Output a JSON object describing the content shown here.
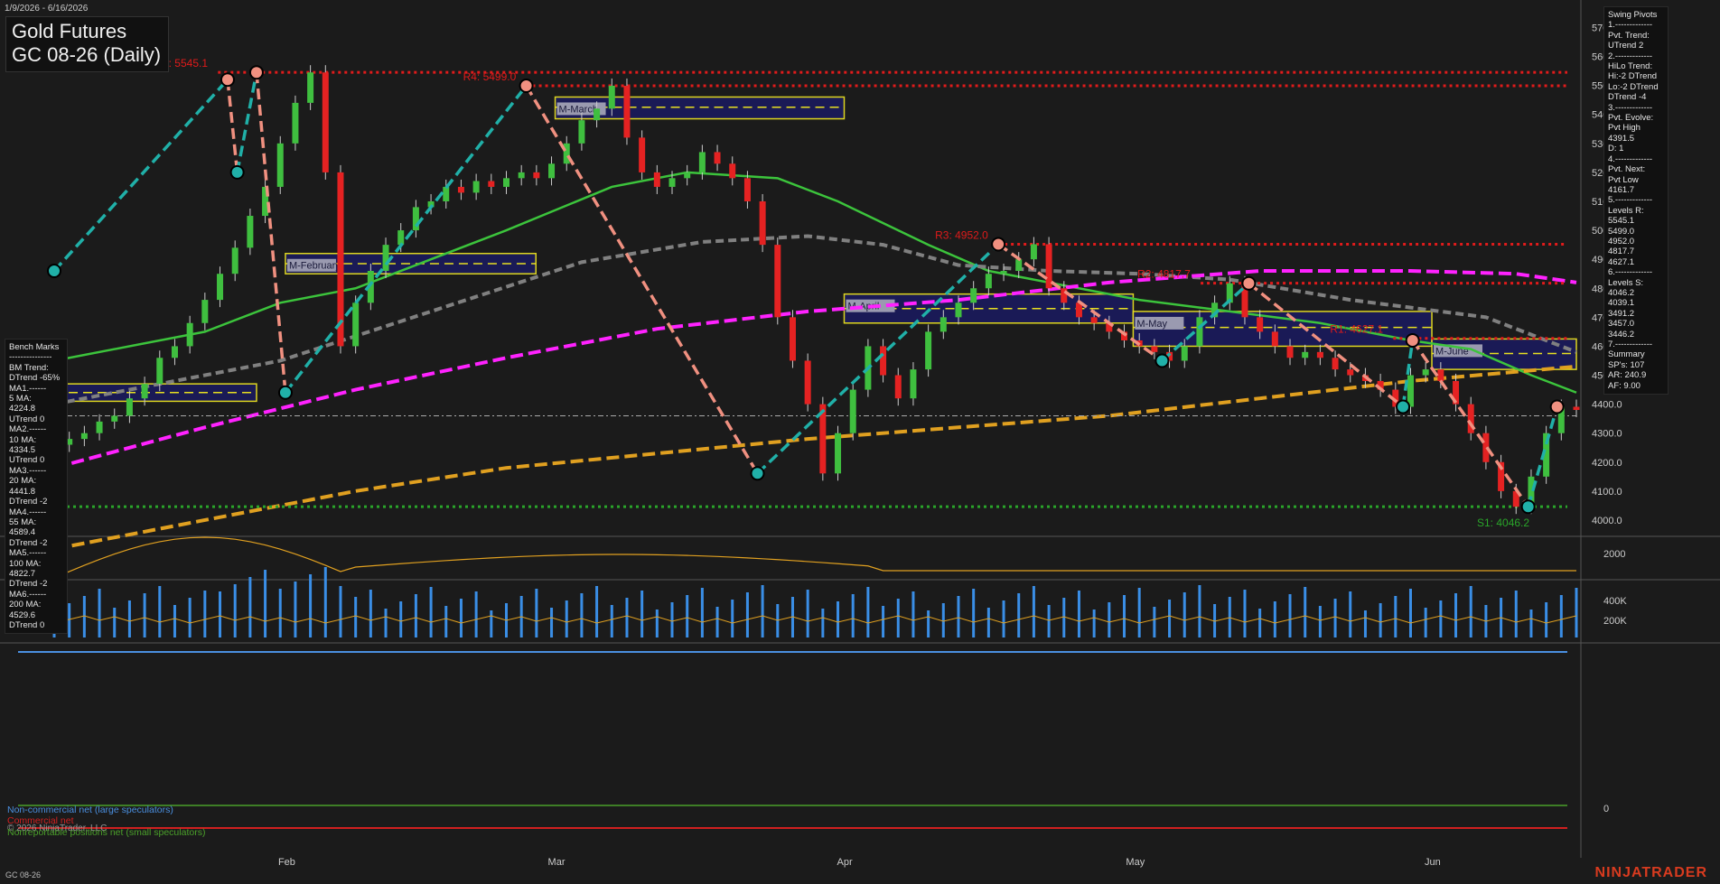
{
  "header": {
    "date_range": "1/9/2026 - 6/16/2026",
    "title_line1": "Gold Futures",
    "title_line2": "GC 08-26 (Daily)"
  },
  "swing_panel": [
    "Swing Pivots",
    "1.-------------",
    "Pvt. Trend:",
    "UTrend 2",
    "2.-------------",
    "HiLo Trend:",
    "Hi:-2 DTrend",
    "Lo:-2 DTrend",
    "DTrend -4",
    "3.-------------",
    "Pvt. Evolve:",
    "Pvt High",
    "4391.5",
    "D: 1",
    "4.-------------",
    "Pvt. Next:",
    "Pvt Low",
    "4161.7",
    "5.-------------",
    "Levels R:",
    "5545.1",
    "5499.0",
    "4952.0",
    "4817.7",
    "4627.1",
    "6.-------------",
    "Levels S:",
    "4046.2",
    "4039.1",
    "3491.2",
    "3457.0",
    "3446.2",
    "7.-------------",
    "Summary",
    "SP's: 107",
    "AR: 240.9",
    "AF: 9.00"
  ],
  "bench_panel": [
    "Bench Marks",
    "---------------",
    "BM Trend:",
    "DTrend -65%",
    "MA1.------",
    "5 MA:",
    "4224.8",
    "UTrend 0",
    "MA2.------",
    "10 MA:",
    "4334.5",
    "UTrend 0",
    "MA3.------",
    "20 MA:",
    "4441.8",
    "DTrend -2",
    "MA4.------",
    "55 MA:",
    "4589.4",
    "DTrend -2",
    "MA5.------",
    "100 MA:",
    "4822.7",
    "DTrend -2",
    "MA6.------",
    "200 MA:",
    "4529.6",
    "DTrend 0"
  ],
  "footer": {
    "symbol": "GC 08-26",
    "brand": "NINJATRADER",
    "copyright": "© 2026 NinjaTrader, LLC"
  },
  "cot_legend": [
    {
      "label": "Non-commercial net (large speculators)",
      "color": "#4a8fe0"
    },
    {
      "label": "Commercial net",
      "color": "#d02020"
    },
    {
      "label": "Nonreportable positions net (small speculators)",
      "color": "#4aa02a"
    }
  ],
  "colors": {
    "bg": "#1b1b1b",
    "up": "#3fbf3f",
    "down": "#e52222",
    "resistance": "#e01b1b",
    "support": "#2aa52a",
    "ma_green": "#3cc43c",
    "ma_gray": "#808080",
    "ma_magenta": "#ff22ff",
    "ma_orange": "#e0a020",
    "swing_up": "#20b0a8",
    "swing_down": "#f09080",
    "zone_fill": "#1a1a5a",
    "zone_border": "#e8e020"
  },
  "chart_data": {
    "type": "candlestick",
    "price_ticks": [
      4000,
      4100,
      4200,
      4300,
      4400,
      4500,
      4600,
      4700,
      4800,
      4900,
      5000,
      5100,
      5200,
      5300,
      5400,
      5500,
      5600,
      5700
    ],
    "price_tick_labels": [
      "4000.0",
      "4100.0",
      "4200.0",
      "4300.0",
      "4400.0",
      "4500.0",
      "4600.0",
      "4700.0",
      "4800.0",
      "4900.0",
      "5000.0",
      "5100.0",
      "5200.0",
      "5300.0",
      "5400.0",
      "5500.0",
      "5600.0",
      "5700.0"
    ],
    "ylim": [
      3950,
      5770
    ],
    "months": [
      {
        "label": "Feb",
        "date": "2026-02-02"
      },
      {
        "label": "Mar",
        "date": "2026-03-02"
      },
      {
        "label": "Apr",
        "date": "2026-04-01"
      },
      {
        "label": "May",
        "date": "2026-05-01"
      },
      {
        "label": "Jun",
        "date": "2026-06-01"
      }
    ],
    "start_date": "2026-01-09",
    "end_date": "2026-06-16",
    "close_series": [
      4260,
      4280,
      4300,
      4340,
      4360,
      4420,
      4470,
      4560,
      4600,
      4680,
      4760,
      4850,
      4940,
      5050,
      5150,
      5300,
      5440,
      5545,
      5200,
      4600,
      4750,
      4860,
      4950,
      5000,
      5080,
      5100,
      5150,
      5130,
      5170,
      5150,
      5180,
      5200,
      5180,
      5230,
      5300,
      5380,
      5420,
      5499,
      5320,
      5200,
      5150,
      5180,
      5200,
      5270,
      5230,
      5180,
      5100,
      4950,
      4700,
      4550,
      4400,
      4161,
      4300,
      4450,
      4600,
      4500,
      4420,
      4520,
      4650,
      4700,
      4750,
      4800,
      4850,
      4860,
      4900,
      4952,
      4800,
      4750,
      4700,
      4680,
      4650,
      4620,
      4600,
      4580,
      4550,
      4600,
      4700,
      4750,
      4817,
      4700,
      4650,
      4600,
      4560,
      4580,
      4560,
      4520,
      4500,
      4480,
      4450,
      4391,
      4500,
      4520,
      4480,
      4400,
      4300,
      4200,
      4100,
      4046,
      4150,
      4300,
      4391,
      4380
    ],
    "resistance_levels": [
      {
        "label": "R5: 5545.1",
        "value": 5545.1,
        "start": "2026-01-26"
      },
      {
        "label": "R4: 5499.0",
        "value": 5499.0,
        "start": "2026-02-27"
      },
      {
        "label": "R3: 4952.0",
        "value": 4952.0,
        "start": "2026-04-17"
      },
      {
        "label": "R2: 4817.7",
        "value": 4817.7,
        "start": "2026-05-08"
      },
      {
        "label": "R1: 4627.1",
        "value": 4627.1,
        "start": "2026-05-28"
      }
    ],
    "support_levels": [
      {
        "label": "S1: 4046.2",
        "value": 4046.2,
        "start": "2026-01-09"
      }
    ],
    "last_price": 4360,
    "zones": [
      {
        "label": "M-March",
        "start": "2026-03-02",
        "end": "2026-04-01",
        "top": 5460,
        "bottom": 5385,
        "mid": 5425
      },
      {
        "label": "M-February",
        "start": "2026-02-02",
        "end": "2026-02-28",
        "top": 4920,
        "bottom": 4850,
        "mid": 4885
      },
      {
        "label": "M-April",
        "start": "2026-04-01",
        "end": "2026-05-01",
        "top": 4780,
        "bottom": 4680,
        "mid": 4730
      },
      {
        "label": "M-May",
        "start": "2026-05-01",
        "end": "2026-06-01",
        "top": 4720,
        "bottom": 4600,
        "mid": 4665
      },
      {
        "label": "M-June",
        "start": "2026-06-01",
        "end": "2026-06-16",
        "top": 4625,
        "bottom": 4520,
        "mid": 4575
      },
      {
        "label": "",
        "start": "2026-01-09",
        "end": "2026-01-30",
        "top": 4470,
        "bottom": 4410,
        "mid": 4440
      }
    ],
    "swing_points": [
      {
        "date": "2026-01-09",
        "value": 4860
      },
      {
        "date": "2026-01-27",
        "value": 5520
      },
      {
        "date": "2026-01-28",
        "value": 5200
      },
      {
        "date": "2026-01-30",
        "value": 5545
      },
      {
        "date": "2026-02-02",
        "value": 4440
      },
      {
        "date": "2026-02-27",
        "value": 5499
      },
      {
        "date": "2026-03-23",
        "value": 4161
      },
      {
        "date": "2026-04-17",
        "value": 4952
      },
      {
        "date": "2026-05-04",
        "value": 4550
      },
      {
        "date": "2026-05-13",
        "value": 4817
      },
      {
        "date": "2026-05-29",
        "value": 4391
      },
      {
        "date": "2026-05-30",
        "value": 4620
      },
      {
        "date": "2026-06-11",
        "value": 4046
      },
      {
        "date": "2026-06-14",
        "value": 4391
      }
    ],
    "ma_series": [
      {
        "name": "20 MA",
        "color": "#3cc43c",
        "points": [
          [
            0,
            4550
          ],
          [
            10,
            4650
          ],
          [
            15,
            4750
          ],
          [
            20,
            4800
          ],
          [
            30,
            5000
          ],
          [
            37,
            5150
          ],
          [
            42,
            5200
          ],
          [
            48,
            5180
          ],
          [
            52,
            5100
          ],
          [
            58,
            4950
          ],
          [
            62,
            4860
          ],
          [
            66,
            4820
          ],
          [
            72,
            4760
          ],
          [
            78,
            4720
          ],
          [
            84,
            4680
          ],
          [
            90,
            4620
          ],
          [
            94,
            4590
          ],
          [
            98,
            4500
          ],
          [
            101,
            4440
          ]
        ]
      },
      {
        "name": "55 MA",
        "color": "#808080",
        "points": [
          [
            0,
            4400
          ],
          [
            15,
            4550
          ],
          [
            25,
            4720
          ],
          [
            35,
            4890
          ],
          [
            43,
            4960
          ],
          [
            50,
            4980
          ],
          [
            55,
            4950
          ],
          [
            60,
            4880
          ],
          [
            66,
            4860
          ],
          [
            72,
            4850
          ],
          [
            78,
            4830
          ],
          [
            86,
            4760
          ],
          [
            95,
            4700
          ],
          [
            101,
            4580
          ]
        ]
      },
      {
        "name": "100 MA",
        "color": "#ff22ff",
        "points": [
          [
            0,
            4180
          ],
          [
            10,
            4320
          ],
          [
            20,
            4450
          ],
          [
            30,
            4560
          ],
          [
            40,
            4660
          ],
          [
            50,
            4720
          ],
          [
            60,
            4760
          ],
          [
            70,
            4820
          ],
          [
            80,
            4860
          ],
          [
            90,
            4860
          ],
          [
            97,
            4850
          ],
          [
            101,
            4820
          ]
        ]
      },
      {
        "name": "200 MA",
        "color": "#e0a020",
        "points": [
          [
            0,
            3900
          ],
          [
            10,
            4000
          ],
          [
            20,
            4100
          ],
          [
            30,
            4180
          ],
          [
            40,
            4230
          ],
          [
            50,
            4280
          ],
          [
            60,
            4320
          ],
          [
            70,
            4360
          ],
          [
            80,
            4420
          ],
          [
            90,
            4480
          ],
          [
            101,
            4530
          ]
        ]
      }
    ],
    "sub1_ticks": [
      {
        "value": 2000,
        "label": "2000"
      }
    ],
    "sub2_ticks": [
      {
        "value": 200000,
        "label": "200K"
      },
      {
        "value": 400000,
        "label": "400K"
      }
    ],
    "sub3_ticks": [
      {
        "value": 0,
        "label": "0"
      }
    ]
  }
}
